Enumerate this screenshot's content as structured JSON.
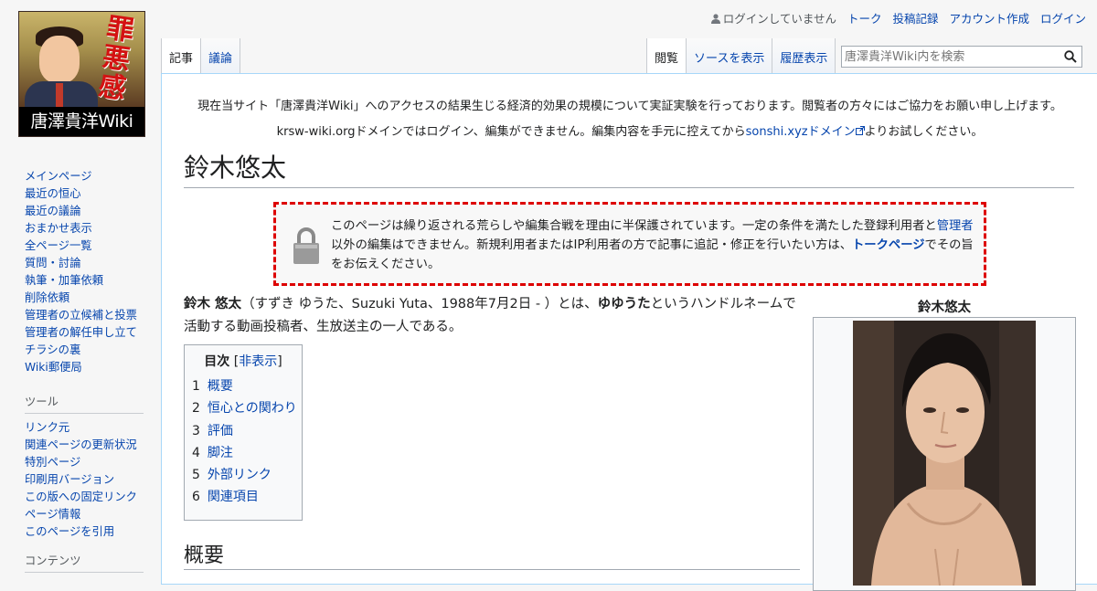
{
  "logo": {
    "title": "唐澤貴洋Wiki",
    "kanji": "罪悪感",
    "kanji_alt": "あり"
  },
  "personal": {
    "not_logged_in": "ログインしていません",
    "talk": "トーク",
    "contributions": "投稿記録",
    "create_account": "アカウント作成",
    "login": "ログイン"
  },
  "tabs": {
    "article": "記事",
    "discussion": "議論",
    "read": "閲覧",
    "view_source": "ソースを表示",
    "history": "履歴表示"
  },
  "search": {
    "placeholder": "唐澤貴洋Wiki内を検索"
  },
  "sidebar": {
    "nav": [
      "メインページ",
      "最近の恒心",
      "最近の議論",
      "おまかせ表示",
      "全ページ一覧",
      "質問・討論",
      "執筆・加筆依頼",
      "削除依頼",
      "管理者の立候補と投票",
      "管理者の解任申し立て",
      "チラシの裏",
      "Wiki郵便局"
    ],
    "tools_heading": "ツール",
    "tools": [
      "リンク元",
      "関連ページの更新状況",
      "特別ページ",
      "印刷用バージョン",
      "この版への固定リンク",
      "ページ情報",
      "このページを引用"
    ],
    "contents_heading": "コンテンツ"
  },
  "sitenotice": {
    "line1": "現在当サイト「唐澤貴洋Wiki」へのアクセスの結果生じる経済的効果の規模について実証実験を行っております。閲覧者の方々にはご協力をお願い申し上げます。",
    "line2_pre": "krsw-wiki.orgドメインではログイン、編集ができません。編集内容を手元に控えてから",
    "line2_link": "sonshi.xyzドメイン",
    "line2_post": "よりお試しください。"
  },
  "page": {
    "title": "鈴木悠太",
    "protection": {
      "text1": "このページは繰り返される荒らしや編集合戦を理由に半保護されています。一定の条件を満たした登録利用者と",
      "link_admin": "管理者",
      "text2": "以外の編集はできません。新規利用者またはIP利用者の方で記事に追記・修正を行いたい方は、",
      "link_talk": "トークページ",
      "text3": "でその旨をお伝えください。"
    },
    "intro": {
      "bold_name": "鈴木 悠太",
      "part1": "（すずき ゆうた、Suzuki Yuta、1988年7月2日 - ）とは、",
      "bold_handle": "ゆゆうた",
      "part2": "というハンドルネームで活動する動画投稿者、生放送主の一人である。"
    },
    "toc": {
      "title": "目次",
      "toggle_open": "[",
      "toggle": "非表示",
      "toggle_close": "]",
      "items": [
        {
          "num": "1",
          "label": "概要"
        },
        {
          "num": "2",
          "label": "恒心との関わり"
        },
        {
          "num": "3",
          "label": "評価"
        },
        {
          "num": "4",
          "label": "脚注"
        },
        {
          "num": "5",
          "label": "外部リンク"
        },
        {
          "num": "6",
          "label": "関連項目"
        }
      ]
    },
    "section_heading": "概要",
    "infobox_title": "鈴木悠太"
  }
}
